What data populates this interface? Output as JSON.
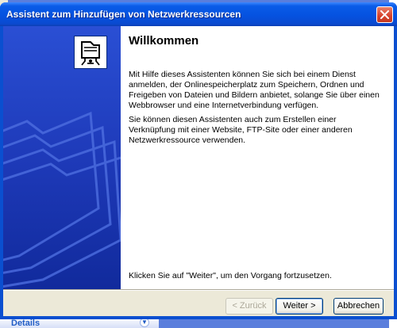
{
  "window": {
    "title": "Assistent zum Hinzufügen von Netzwerkressourcen"
  },
  "wizard": {
    "heading": "Willkommen",
    "paragraph1": "Mit Hilfe dieses Assistenten können Sie sich bei einem Dienst anmelden, der Onlinespeicherplatz zum Speichern, Ordnen und Freigeben von Dateien und Bildern anbietet, solange Sie über einen Webbrowser und eine Internetverbindung verfügen.",
    "paragraph2": "Sie können diesen Assistenten auch zum Erstellen einer Verknüpfung mit einer Website, FTP-Site oder einer anderen Netzwerkressource verwenden.",
    "paragraph3": "Klicken Sie auf \"Weiter\", um den Vorgang fortzusetzen."
  },
  "buttons": {
    "back": "< Zurück",
    "next": "Weiter >",
    "cancel": "Abbrechen"
  },
  "background": {
    "details_label": "Details"
  },
  "colors": {
    "titlebar": "#0552e0",
    "banner": "#1e3ab9",
    "dialog": "#ece9d8"
  }
}
